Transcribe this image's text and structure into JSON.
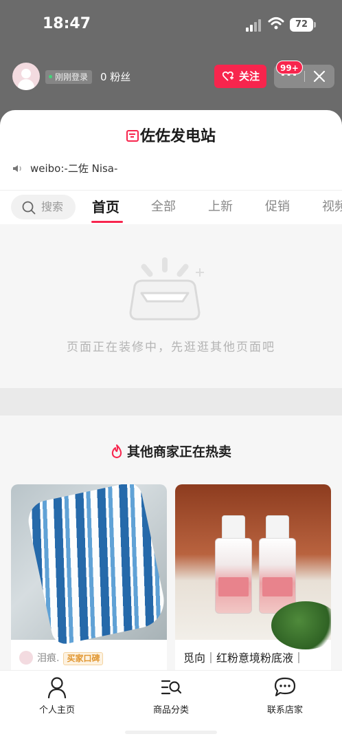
{
  "status_bar": {
    "time": "18:47",
    "battery": "72"
  },
  "shop_header": {
    "login_status": "刚刚登录",
    "fans": "0 粉丝",
    "follow_label": "关注",
    "more_label": "···",
    "badge_count": "99+"
  },
  "shop": {
    "name": "佐佐发电站",
    "notice": "weibo:-二佐 Nisa-"
  },
  "tabs": {
    "search_label": "搜索",
    "items": [
      "首页",
      "全部",
      "上新",
      "促销",
      "视频"
    ],
    "active": "首页"
  },
  "empty_state": {
    "message": "页面正在装修中，先逛逛其他页面吧"
  },
  "hot_section": {
    "title": "其他商家正在热卖",
    "products": [
      {
        "user": "泪痕.",
        "tag": "买家口碑"
      },
      {
        "name": "觅向｜红粉意境粉底液｜"
      }
    ]
  },
  "bottom_nav": {
    "items": [
      {
        "label": "个人主页",
        "icon": "person-icon"
      },
      {
        "label": "商品分类",
        "icon": "category-search-icon"
      },
      {
        "label": "联系店家",
        "icon": "chat-icon"
      }
    ]
  },
  "colors": {
    "accent": "#f7254d",
    "header_bg": "#6b6b6b",
    "tag_orange": "#e1962f"
  }
}
